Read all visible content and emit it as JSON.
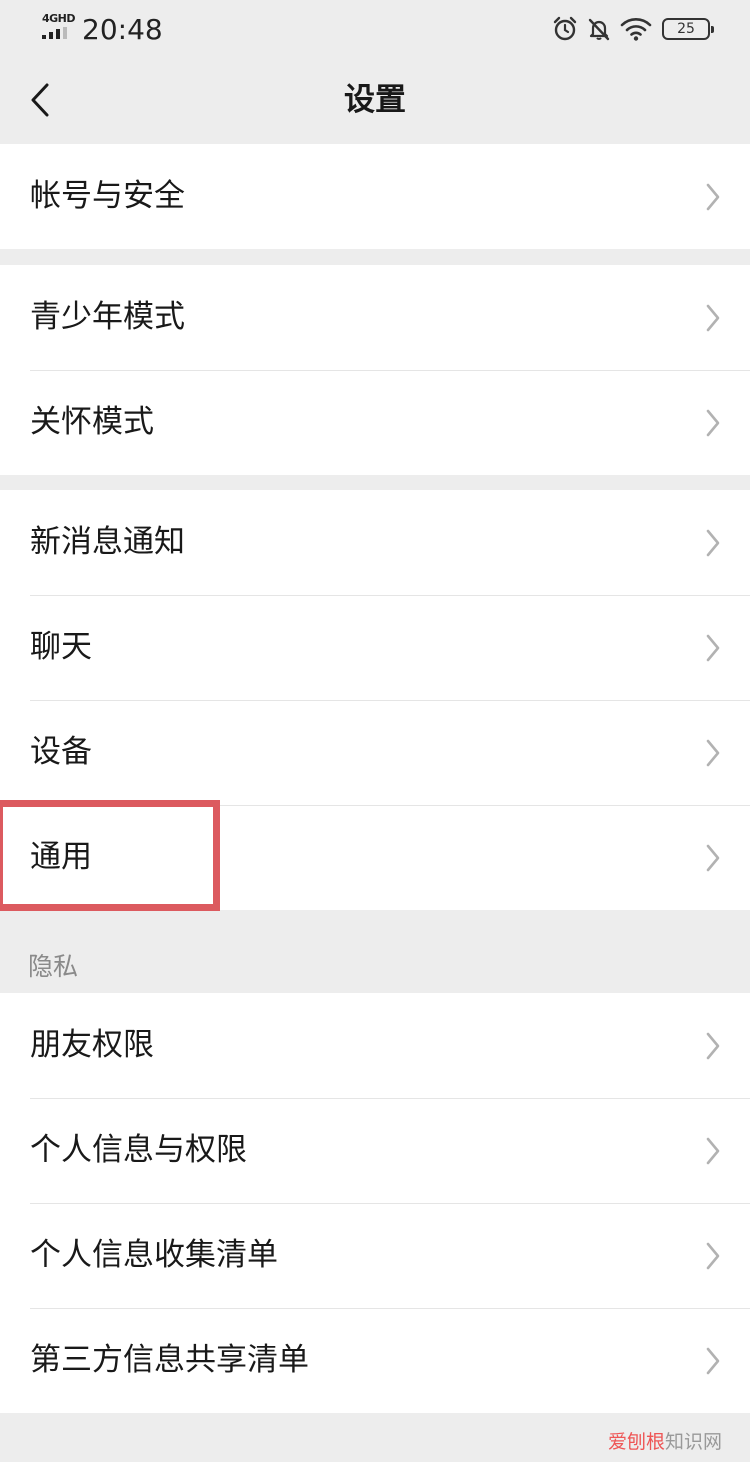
{
  "status_bar": {
    "network": "4GHD",
    "time": "20:48",
    "icons": [
      "alarm-icon",
      "bell-off-icon",
      "wifi-icon",
      "battery-icon"
    ],
    "battery_level": "25"
  },
  "nav": {
    "title": "设置",
    "back_icon": "chevron-left-icon"
  },
  "groups": [
    {
      "items": [
        {
          "label": "帐号与安全"
        }
      ]
    },
    {
      "items": [
        {
          "label": "青少年模式"
        },
        {
          "label": "关怀模式"
        }
      ]
    },
    {
      "items": [
        {
          "label": "新消息通知"
        },
        {
          "label": "聊天"
        },
        {
          "label": "设备"
        },
        {
          "label": "通用",
          "highlighted": true
        }
      ]
    },
    {
      "header": "隐私",
      "items": [
        {
          "label": "朋友权限"
        },
        {
          "label": "个人信息与权限"
        },
        {
          "label": "个人信息收集清单"
        },
        {
          "label": "第三方信息共享清单"
        }
      ]
    }
  ],
  "watermark": {
    "accent": "爱刨根",
    "rest": "知识网"
  },
  "colors": {
    "background": "#ededed",
    "card": "#ffffff",
    "text": "#191919",
    "muted": "#8a8a8a",
    "chevron": "#b2b2b2",
    "highlight": "#dc5a5f"
  }
}
